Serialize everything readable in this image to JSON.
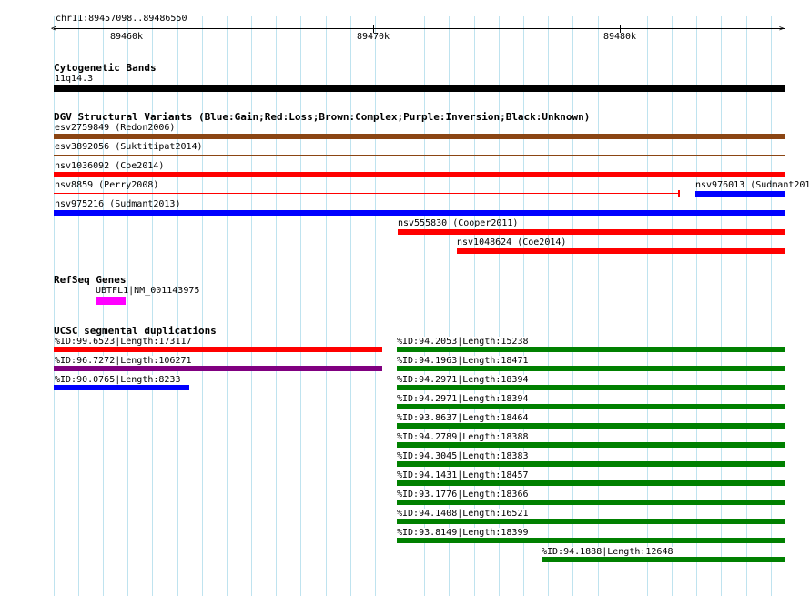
{
  "ruler": {
    "range_label": "chr11:89457098..89486550",
    "ticks": [
      {
        "label": "89460k"
      },
      {
        "label": "89470k"
      },
      {
        "label": "89480k"
      }
    ]
  },
  "tracks": {
    "cytoband": {
      "title": "Cytogenetic Bands",
      "feature": {
        "label": "11q14.3",
        "color": "#000000"
      }
    },
    "dgv": {
      "title": "DGV Structural Variants (Blue:Gain;Red:Loss;Brown:Complex;Purple:Inversion;Black:Unknown)",
      "features": [
        {
          "label": "esv2759849 (Redon2006)",
          "color": "#8b4513"
        },
        {
          "label": "esv3892056 (Suktitipat2014)",
          "color": "#8b4513"
        },
        {
          "label": "nsv1036092 (Coe2014)",
          "color": "#ff0000"
        },
        {
          "label": "nsv8859 (Perry2008)",
          "color": "#ff0000"
        },
        {
          "label": "nsv976013 (Sudmant201",
          "color": "#0000ff"
        },
        {
          "label": "nsv975216 (Sudmant2013)",
          "color": "#0000ff"
        },
        {
          "label": "nsv555830 (Cooper2011)",
          "color": "#ff0000"
        },
        {
          "label": "nsv1048624 (Coe2014)",
          "color": "#ff0000"
        }
      ]
    },
    "refseq": {
      "title": "RefSeq Genes",
      "feature": {
        "label": "UBTFL1|NM_001143975",
        "color": "#ff00ff"
      }
    },
    "segdups": {
      "title": "UCSC segmental duplications",
      "features": [
        {
          "label": "%ID:99.6523|Length:173117",
          "color": "#ff0000"
        },
        {
          "label": "%ID:96.7272|Length:106271",
          "color": "#800080"
        },
        {
          "label": "%ID:90.0765|Length:8233",
          "color": "#0000ff"
        },
        {
          "label": "%ID:94.2053|Length:15238",
          "color": "#008000"
        },
        {
          "label": "%ID:94.1963|Length:18471",
          "color": "#008000"
        },
        {
          "label": "%ID:94.2971|Length:18394",
          "color": "#008000"
        },
        {
          "label": "%ID:94.2971|Length:18394",
          "color": "#008000"
        },
        {
          "label": "%ID:93.8637|Length:18464",
          "color": "#008000"
        },
        {
          "label": "%ID:94.2789|Length:18388",
          "color": "#008000"
        },
        {
          "label": "%ID:94.3045|Length:18383",
          "color": "#008000"
        },
        {
          "label": "%ID:94.1431|Length:18457",
          "color": "#008000"
        },
        {
          "label": "%ID:93.1776|Length:18366",
          "color": "#008000"
        },
        {
          "label": "%ID:94.1408|Length:16521",
          "color": "#008000"
        },
        {
          "label": "%ID:93.8149|Length:18399",
          "color": "#008000"
        },
        {
          "label": "%ID:94.1888|Length:12648",
          "color": "#008000"
        }
      ]
    }
  }
}
